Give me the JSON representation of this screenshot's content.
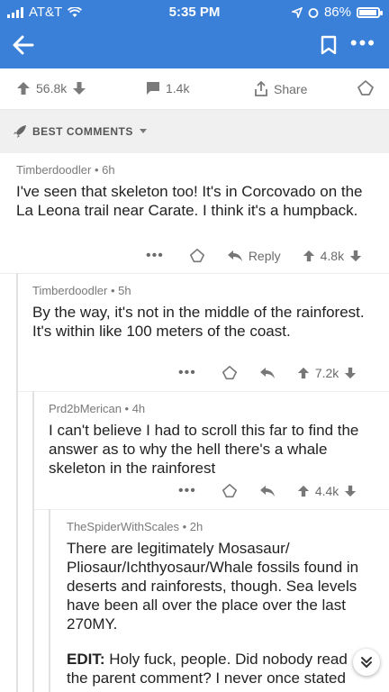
{
  "status": {
    "carrier": "AT&T",
    "time": "5:35 PM",
    "battery": "86%",
    "battery_level": 0.86
  },
  "post": {
    "votes": "56.8k",
    "comments": "1.4k",
    "share_label": "Share"
  },
  "sort_label": "BEST COMMENTS",
  "comments": [
    {
      "author": "Timberdoodler • 6h",
      "body": "I've seen that skeleton too! It's in Corcovado on the La Leona trail near Carate. I think it's a humpback.",
      "reply_label": "Reply",
      "votes": "4.8k"
    },
    {
      "author": "Timberdoodler • 5h",
      "body": "By the way, it's not in the middle of the rainforest. It's within like 100 meters of the coast.",
      "votes": "7.2k"
    },
    {
      "author": "Prd2bMerican • 4h",
      "body": "I can't believe I had to scroll this far to find the answer as to why the hell there's a whale skeleton in the rainforest",
      "votes": "4.4k"
    },
    {
      "author": "TheSpiderWithScales • 2h",
      "body": "There are legitimately Mosasaur/ Pliosaur/Ichthyosaur/Whale fossils found in deserts and rainforests, though. Sea levels have been all over the place over the last 270MY.",
      "edit_label": "EDIT:",
      "edit_body": "Holy fuck, people. Did nobody read the parent comment? I never once stated"
    }
  ],
  "colors": {
    "header": "#3a7fd8",
    "text": "#222222",
    "meta": "#7a7a7a"
  }
}
